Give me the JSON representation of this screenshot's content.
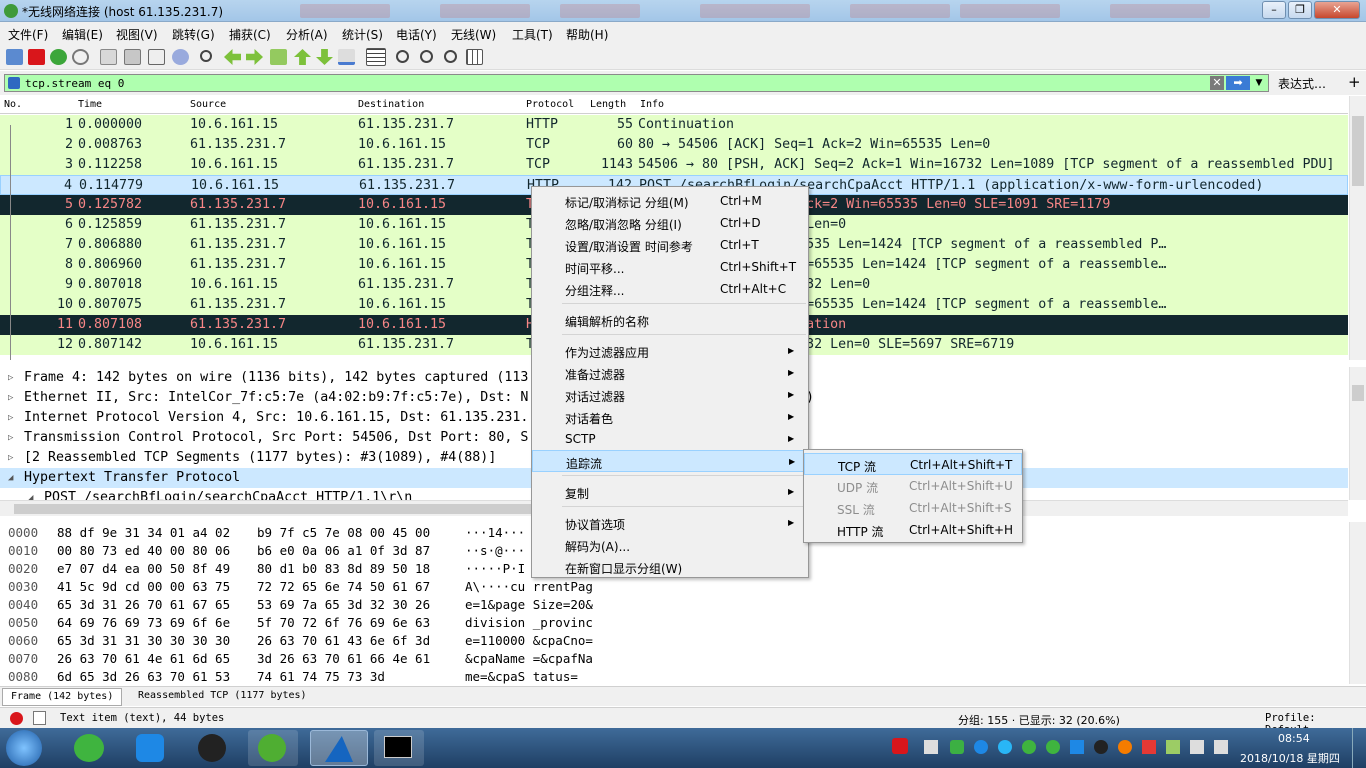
{
  "window": {
    "title": "*无线网络连接 (host 61.135.231.7)",
    "controls": [
      "–",
      "❐",
      "✕"
    ]
  },
  "menubar": [
    "文件(F)",
    "编辑(E)",
    "视图(V)",
    "跳转(G)",
    "捕获(C)",
    "分析(A)",
    "统计(S)",
    "电话(Y)",
    "无线(W)",
    "工具(T)",
    "帮助(H)"
  ],
  "filter": {
    "value": "tcp.stream eq 0",
    "expression_label": "表达式…",
    "plus": "+"
  },
  "columns": [
    "No.",
    "Time",
    "Source",
    "Destination",
    "Protocol",
    "Length",
    "Info"
  ],
  "packets": [
    {
      "no": "1",
      "time": "0.000000",
      "src": "10.6.161.15",
      "dst": "61.135.231.7",
      "proto": "HTTP",
      "len": "55",
      "info": "Continuation",
      "style": "green"
    },
    {
      "no": "2",
      "time": "0.008763",
      "src": "61.135.231.7",
      "dst": "10.6.161.15",
      "proto": "TCP",
      "len": "60",
      "info": "80 → 54506 [ACK] Seq=1 Ack=2 Win=65535 Len=0",
      "style": "green"
    },
    {
      "no": "3",
      "time": "0.112258",
      "src": "10.6.161.15",
      "dst": "61.135.231.7",
      "proto": "TCP",
      "len": "1143",
      "info": "54506 → 80 [PSH, ACK] Seq=2 Ack=1 Win=16732 Len=1089 [TCP segment of a reassembled PDU]",
      "style": "green"
    },
    {
      "no": "4",
      "time": "0.114779",
      "src": "10.6.161.15",
      "dst": "61.135.231.7",
      "proto": "HTTP",
      "len": "142",
      "info": "POST /searchBfLogin/searchCpaAcct HTTP/1.1  (application/x-www-form-urlencoded)",
      "style": "sel"
    },
    {
      "no": "5",
      "time": "0.125782",
      "src": "61.135.231.7",
      "dst": "10.6.161.15",
      "proto": "T",
      "len": "",
      "info": "→ 54506 [ACK] Seq=1 Ack=2 Win=65535 Len=0 SLE=1091 SRE=1179",
      "style": "dark"
    },
    {
      "no": "6",
      "time": "0.125859",
      "src": "61.135.231.7",
      "dst": "10.6.161.15",
      "proto": "T",
      "len": "",
      "info": "1 Ack=1179 Win=65240 Len=0",
      "style": "green"
    },
    {
      "no": "7",
      "time": "0.806880",
      "src": "61.135.231.7",
      "dst": "10.6.161.15",
      "proto": "T",
      "len": "",
      "info": "Seq=1 Ack=1179 Win=65535 Len=1424 [TCP segment of a reassembled P…",
      "style": "green"
    },
    {
      "no": "8",
      "time": "0.806960",
      "src": "61.135.231.7",
      "dst": "10.6.161.15",
      "proto": "T",
      "len": "",
      "info": "Seq=1425 Ack=1179 Win=65535 Len=1424 [TCP segment of a reassemble…",
      "style": "green"
    },
    {
      "no": "9",
      "time": "0.807018",
      "src": "10.6.161.15",
      "dst": "61.135.231.7",
      "proto": "T",
      "len": "",
      "info": "1179 Ack=2849 Win=16732 Len=0",
      "style": "green"
    },
    {
      "no": "10",
      "time": "0.807075",
      "src": "61.135.231.7",
      "dst": "10.6.161.15",
      "proto": "T",
      "len": "",
      "info": "Seq=2849 Ack=1179 Win=65535 Len=1424 [TCP segment of a reassemble…",
      "style": "green"
    },
    {
      "no": "11",
      "time": "0.807108",
      "src": "61.135.231.7",
      "dst": "10.6.161.15",
      "proto": "H",
      "len": "",
      "info": "not captured] Continuation",
      "style": "dark"
    },
    {
      "no": "12",
      "time": "0.807142",
      "src": "10.6.161.15",
      "dst": "61.135.231.7",
      "proto": "T",
      "len": "",
      "info": "1179 Ack=4273 Win=16732 Len=0 SLE=5697 SRE=6719",
      "style": "green"
    }
  ],
  "details": [
    {
      "text": "Frame 4: 142 bytes on wire (1136 bits), 142 bytes captured (113",
      "tail": "",
      "hl": false,
      "indent": 0,
      "tri": "▷"
    },
    {
      "text": "Ethernet II, Src: IntelCor_7f:c5:7e (a4:02:b9:7f:c5:7e), Dst: N",
      "tail": ")",
      "hl": false,
      "indent": 0,
      "tri": "▷"
    },
    {
      "text": "Internet Protocol Version 4, Src: 10.6.161.15, Dst: 61.135.231.",
      "tail": "",
      "hl": false,
      "indent": 0,
      "tri": "▷"
    },
    {
      "text": "Transmission Control Protocol, Src Port: 54506, Dst Port: 80, S",
      "tail": "",
      "hl": false,
      "indent": 0,
      "tri": "▷"
    },
    {
      "text": "[2 Reassembled TCP Segments (1177 bytes): #3(1089), #4(88)]",
      "tail": "",
      "hl": false,
      "indent": 0,
      "tri": "▷"
    },
    {
      "text": "Hypertext Transfer Protocol",
      "tail": "",
      "hl": true,
      "indent": 0,
      "tri": "◢"
    },
    {
      "text": "POST /searchBfLogin/searchCpaAcct HTTP/1.1\\r\\n",
      "tail": "",
      "hl": false,
      "indent": 1,
      "tri": "◢"
    }
  ],
  "hex": [
    {
      "off": "0000",
      "bytes1": "88 df 9e 31 34 01 a4 02",
      "bytes2": "b9 7f c5 7e 08 00 45 00",
      "ascii": "···14···"
    },
    {
      "off": "0010",
      "bytes1": "00 80 73 ed 40 00 80 06",
      "bytes2": "b6 e0 0a 06 a1 0f 3d 87",
      "ascii": "··s·@···"
    },
    {
      "off": "0020",
      "bytes1": "e7 07 d4 ea 00 50 8f 49",
      "bytes2": "80 d1 b0 83 8d 89 50 18",
      "ascii": "·····P·I"
    },
    {
      "off": "0030",
      "bytes1": "41 5c 9d cd 00 00 63 75",
      "bytes2": "72 72 65 6e 74 50 61 67",
      "ascii": "A\\····cu rrentPag"
    },
    {
      "off": "0040",
      "bytes1": "65 3d 31 26 70 61 67 65",
      "bytes2": "53 69 7a 65 3d 32 30 26",
      "ascii": "e=1&page Size=20&"
    },
    {
      "off": "0050",
      "bytes1": "64 69 76 69 73 69 6f 6e",
      "bytes2": "5f 70 72 6f 76 69 6e 63",
      "ascii": "division _provinc"
    },
    {
      "off": "0060",
      "bytes1": "65 3d 31 31 30 30 30 30",
      "bytes2": "26 63 70 61 43 6e 6f 3d",
      "ascii": "e=110000 &cpaCno="
    },
    {
      "off": "0070",
      "bytes1": "26 63 70 61 4e 61 6d 65",
      "bytes2": "3d 26 63 70 61 66 4e 61",
      "ascii": "&cpaName =&cpafNa"
    },
    {
      "off": "0080",
      "bytes1": "6d 65 3d 26 63 70 61 53",
      "bytes2": "74 61 74 75 73 3d",
      "ascii": "me=&cpaS tatus="
    }
  ],
  "bytetabs": [
    "Frame (142 bytes)",
    "Reassembled TCP (1177 bytes)"
  ],
  "status": {
    "left": "Text item (text), 44 bytes",
    "middle": "分组: 155 · 已显示: 32 (20.6%)",
    "right": "Profile: Default"
  },
  "context_menu": [
    {
      "label": "标记/取消标记 分组(M)",
      "shortcut": "Ctrl+M",
      "sub": false,
      "sep_after": false
    },
    {
      "label": "忽略/取消忽略 分组(I)",
      "shortcut": "Ctrl+D",
      "sub": false,
      "sep_after": false
    },
    {
      "label": "设置/取消设置 时间参考",
      "shortcut": "Ctrl+T",
      "sub": false,
      "sep_after": false
    },
    {
      "label": "时间平移...",
      "shortcut": "Ctrl+Shift+T",
      "sub": false,
      "sep_after": false
    },
    {
      "label": "分组注释...",
      "shortcut": "Ctrl+Alt+C",
      "sub": false,
      "sep_after": true
    },
    {
      "label": "编辑解析的名称",
      "shortcut": "",
      "sub": false,
      "sep_after": true
    },
    {
      "label": "作为过滤器应用",
      "shortcut": "",
      "sub": true,
      "sep_after": false
    },
    {
      "label": "准备过滤器",
      "shortcut": "",
      "sub": true,
      "sep_after": false
    },
    {
      "label": "对话过滤器",
      "shortcut": "",
      "sub": true,
      "sep_after": false
    },
    {
      "label": "对话着色",
      "shortcut": "",
      "sub": true,
      "sep_after": false
    },
    {
      "label": "SCTP",
      "shortcut": "",
      "sub": true,
      "sep_after": false
    },
    {
      "label": "追踪流",
      "shortcut": "",
      "sub": true,
      "sep_after": true
    },
    {
      "label": "复制",
      "shortcut": "",
      "sub": true,
      "sep_after": true
    },
    {
      "label": "协议首选项",
      "shortcut": "",
      "sub": true,
      "sep_after": false
    },
    {
      "label": "解码为(A)...",
      "shortcut": "",
      "sub": false,
      "sep_after": false
    },
    {
      "label": "在新窗口显示分组(W)",
      "shortcut": "",
      "sub": false,
      "sep_after": false
    }
  ],
  "submenu": [
    {
      "label": "TCP 流",
      "shortcut": "Ctrl+Alt+Shift+T",
      "enabled": true
    },
    {
      "label": "UDP 流",
      "shortcut": "Ctrl+Alt+Shift+U",
      "enabled": false
    },
    {
      "label": "SSL 流",
      "shortcut": "Ctrl+Alt+Shift+S",
      "enabled": false
    },
    {
      "label": "HTTP 流",
      "shortcut": "Ctrl+Alt+Shift+H",
      "enabled": true
    }
  ],
  "taskbar": {
    "time": "08:54",
    "date": "2018/10/18 星期四"
  },
  "colors": {
    "green_row": "#e4ffc7",
    "dark_row": "#12272e",
    "dark_text": "#f78787",
    "selected": "#cce8ff",
    "filter_bg": "#afffaf"
  }
}
